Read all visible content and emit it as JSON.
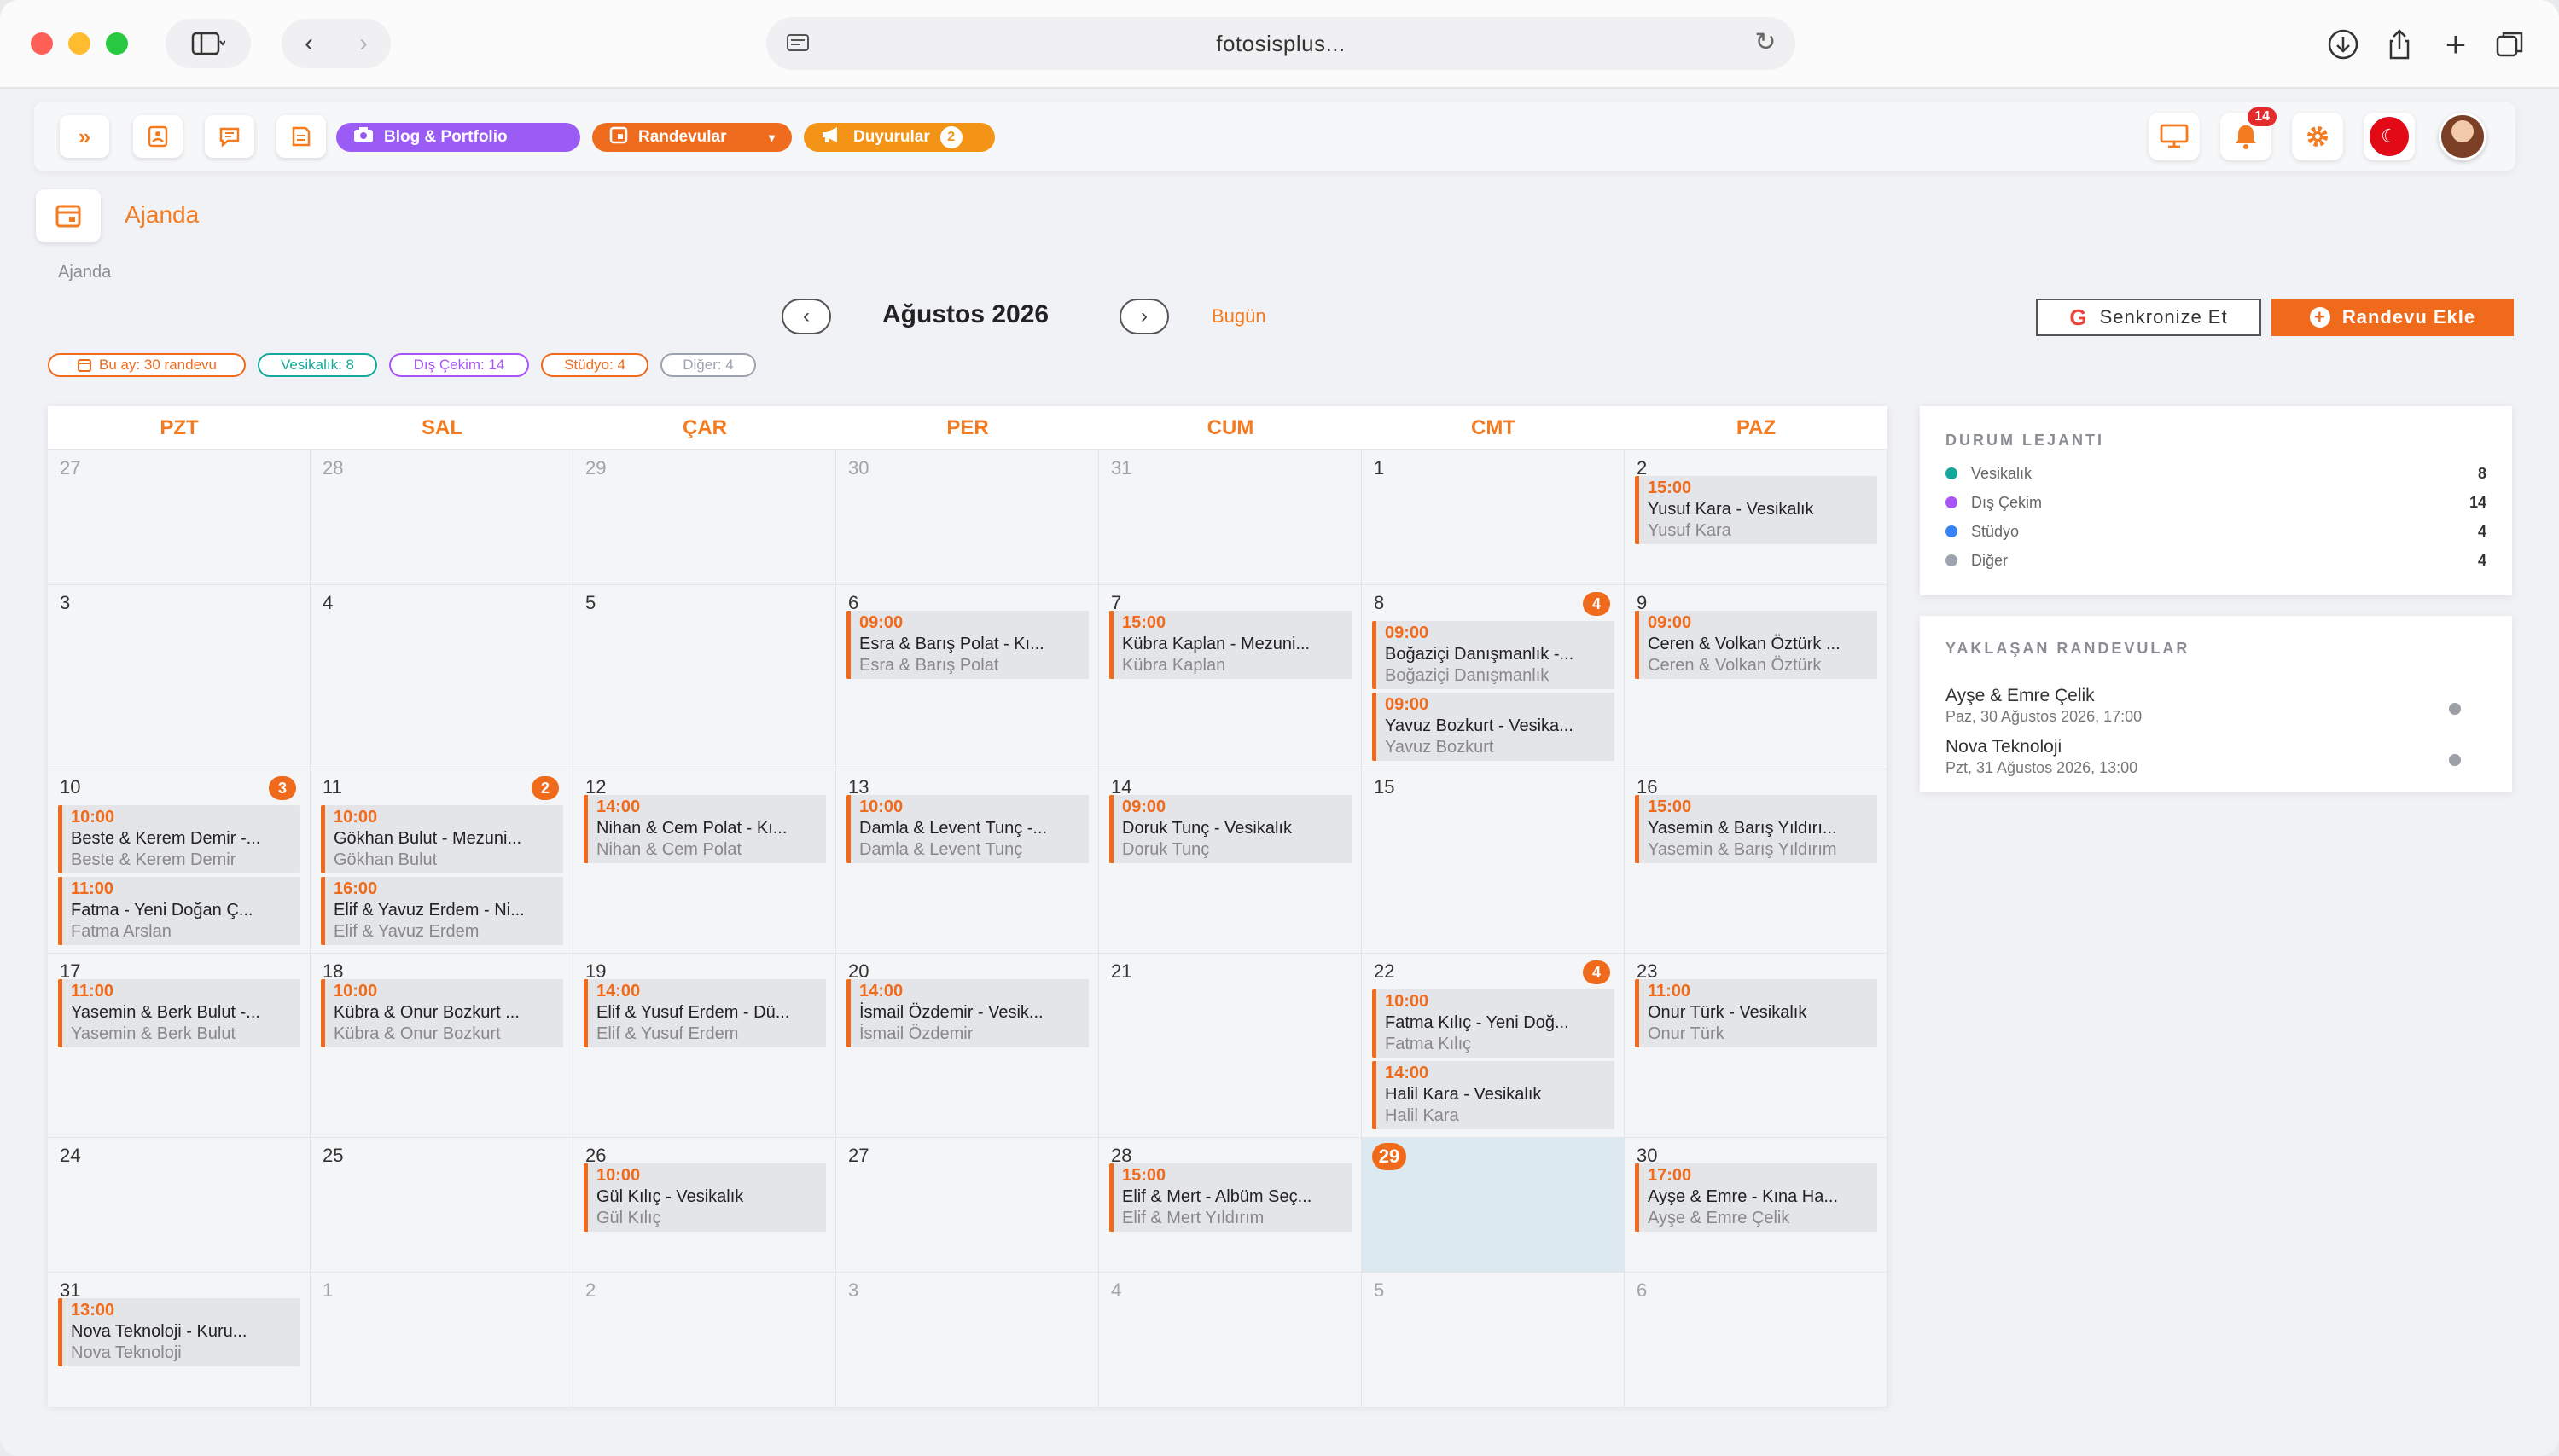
{
  "browser": {
    "url": "fotosisplus...",
    "colors": {
      "close": "#fe5f57",
      "minimize": "#febc2e",
      "maximize": "#28c840"
    }
  },
  "topbar": {
    "pill_blog": "Blog & Portfolio",
    "pill_appointments": "Randevular",
    "pill_announcements": "Duyurular",
    "announcements_count": "2",
    "notifications_count": "14",
    "icons": [
      "chevrons-right-icon",
      "address-book-icon",
      "chat-icon",
      "document-icon",
      "monitor-icon",
      "bell-icon",
      "gear-icon",
      "turkey-flag-icon",
      "avatar"
    ]
  },
  "page": {
    "title": "Ajanda",
    "breadcrumb": "Ajanda",
    "month_title": "Ağustos 2026",
    "today_label": "Bugün",
    "sync_label": "Senkronize Et",
    "add_label": "Randevu Ekle"
  },
  "stats": [
    {
      "label": "Bu ay: 30 randevu",
      "color": "#f06a1c"
    },
    {
      "label": "Vesikalık: 8",
      "color": "#15a89a"
    },
    {
      "label": "Dış Çekim: 14",
      "color": "#a855f7"
    },
    {
      "label": "Stüdyo: 4",
      "color": "#f06a1c"
    },
    {
      "label": "Diğer: 4",
      "color": "#9ca3af"
    }
  ],
  "weekdays": [
    "PZT",
    "SAL",
    "ÇAR",
    "PER",
    "CUM",
    "CMT",
    "PAZ"
  ],
  "weeks": [
    [
      {
        "day": "27",
        "other": true,
        "events": []
      },
      {
        "day": "28",
        "other": true,
        "events": []
      },
      {
        "day": "29",
        "other": true,
        "events": []
      },
      {
        "day": "30",
        "other": true,
        "events": []
      },
      {
        "day": "31",
        "other": true,
        "events": []
      },
      {
        "day": "1",
        "events": []
      },
      {
        "day": "2",
        "events": [
          {
            "time": "15:00",
            "title": "Yusuf Kara - Vesikalık",
            "client": "Yusuf Kara"
          }
        ]
      }
    ],
    [
      {
        "day": "3",
        "events": []
      },
      {
        "day": "4",
        "events": []
      },
      {
        "day": "5",
        "events": []
      },
      {
        "day": "6",
        "events": [
          {
            "time": "09:00",
            "title": "Esra & Barış Polat - Kı...",
            "client": "Esra & Barış Polat"
          }
        ]
      },
      {
        "day": "7",
        "events": [
          {
            "time": "15:00",
            "title": "Kübra Kaplan - Mezuni...",
            "client": "Kübra Kaplan"
          }
        ]
      },
      {
        "day": "8",
        "badge": "4",
        "events": [
          {
            "time": "09:00",
            "title": "Boğaziçi Danışmanlık -...",
            "client": "Boğaziçi Danışmanlık"
          },
          {
            "time": "09:00",
            "title": "Yavuz Bozkurt - Vesika...",
            "client": "Yavuz Bozkurt"
          }
        ]
      },
      {
        "day": "9",
        "events": [
          {
            "time": "09:00",
            "title": "Ceren & Volkan Öztürk ...",
            "client": "Ceren & Volkan Öztürk"
          }
        ]
      }
    ],
    [
      {
        "day": "10",
        "badge": "3",
        "events": [
          {
            "time": "10:00",
            "title": "Beste & Kerem Demir -...",
            "client": "Beste & Kerem Demir"
          },
          {
            "time": "11:00",
            "title": "Fatma - Yeni Doğan Ç...",
            "client": "Fatma Arslan"
          }
        ]
      },
      {
        "day": "11",
        "badge": "2",
        "events": [
          {
            "time": "10:00",
            "title": "Gökhan Bulut - Mezuni...",
            "client": "Gökhan Bulut"
          },
          {
            "time": "16:00",
            "title": "Elif & Yavuz Erdem - Ni...",
            "client": "Elif & Yavuz Erdem"
          }
        ]
      },
      {
        "day": "12",
        "events": [
          {
            "time": "14:00",
            "title": "Nihan & Cem Polat - Kı...",
            "client": "Nihan & Cem Polat"
          }
        ]
      },
      {
        "day": "13",
        "events": [
          {
            "time": "10:00",
            "title": "Damla & Levent Tunç -...",
            "client": "Damla & Levent Tunç"
          }
        ]
      },
      {
        "day": "14",
        "events": [
          {
            "time": "09:00",
            "title": "Doruk Tunç - Vesikalık",
            "client": "Doruk Tunç"
          }
        ]
      },
      {
        "day": "15",
        "events": []
      },
      {
        "day": "16",
        "events": [
          {
            "time": "15:00",
            "title": "Yasemin & Barış Yıldırı...",
            "client": "Yasemin & Barış Yıldırım"
          }
        ]
      }
    ],
    [
      {
        "day": "17",
        "events": [
          {
            "time": "11:00",
            "title": "Yasemin & Berk Bulut -...",
            "client": "Yasemin & Berk Bulut"
          }
        ]
      },
      {
        "day": "18",
        "events": [
          {
            "time": "10:00",
            "title": "Kübra & Onur Bozkurt ...",
            "client": "Kübra & Onur Bozkurt"
          }
        ]
      },
      {
        "day": "19",
        "events": [
          {
            "time": "14:00",
            "title": "Elif & Yusuf Erdem - Dü...",
            "client": "Elif & Yusuf Erdem"
          }
        ]
      },
      {
        "day": "20",
        "events": [
          {
            "time": "14:00",
            "title": "İsmail Özdemir - Vesik...",
            "client": "İsmail Özdemir"
          }
        ]
      },
      {
        "day": "21",
        "events": []
      },
      {
        "day": "22",
        "badge": "4",
        "events": [
          {
            "time": "10:00",
            "title": "Fatma Kılıç - Yeni Doğ...",
            "client": "Fatma Kılıç"
          },
          {
            "time": "14:00",
            "title": "Halil Kara - Vesikalık",
            "client": "Halil Kara"
          }
        ]
      },
      {
        "day": "23",
        "events": [
          {
            "time": "11:00",
            "title": "Onur Türk - Vesikalık",
            "client": "Onur Türk"
          }
        ]
      }
    ],
    [
      {
        "day": "24",
        "events": []
      },
      {
        "day": "25",
        "events": []
      },
      {
        "day": "26",
        "events": [
          {
            "time": "10:00",
            "title": "Gül Kılıç - Vesikalık",
            "client": "Gül Kılıç"
          }
        ]
      },
      {
        "day": "27",
        "events": []
      },
      {
        "day": "28",
        "events": [
          {
            "time": "15:00",
            "title": "Elif & Mert - Albüm Seç...",
            "client": "Elif & Mert Yıldırım"
          }
        ]
      },
      {
        "day": "29",
        "today": true,
        "events": []
      },
      {
        "day": "30",
        "events": [
          {
            "time": "17:00",
            "title": "Ayşe & Emre - Kına Ha...",
            "client": "Ayşe & Emre Çelik"
          }
        ]
      }
    ],
    [
      {
        "day": "31",
        "events": [
          {
            "time": "13:00",
            "title": "Nova Teknoloji - Kuru...",
            "client": "Nova Teknoloji"
          }
        ]
      },
      {
        "day": "1",
        "other": true,
        "events": []
      },
      {
        "day": "2",
        "other": true,
        "events": []
      },
      {
        "day": "3",
        "other": true,
        "events": []
      },
      {
        "day": "4",
        "other": true,
        "events": []
      },
      {
        "day": "5",
        "other": true,
        "events": []
      },
      {
        "day": "6",
        "other": true,
        "events": []
      }
    ]
  ],
  "legend": {
    "title": "DURUM LEJANTI",
    "items": [
      {
        "label": "Vesikalık",
        "count": "8",
        "color": "#15a89a"
      },
      {
        "label": "Dış Çekim",
        "count": "14",
        "color": "#a855f7"
      },
      {
        "label": "Stüdyo",
        "count": "4",
        "color": "#3b82f6"
      },
      {
        "label": "Diğer",
        "count": "4",
        "color": "#9ca3af"
      }
    ]
  },
  "upcoming": {
    "title": "YAKLAŞAN RANDEVULAR",
    "items": [
      {
        "name": "Ayşe & Emre Çelik",
        "date": "Paz, 30 Ağustos 2026, 17:00"
      },
      {
        "name": "Nova Teknoloji",
        "date": "Pzt, 31 Ağustos 2026, 13:00"
      }
    ]
  }
}
